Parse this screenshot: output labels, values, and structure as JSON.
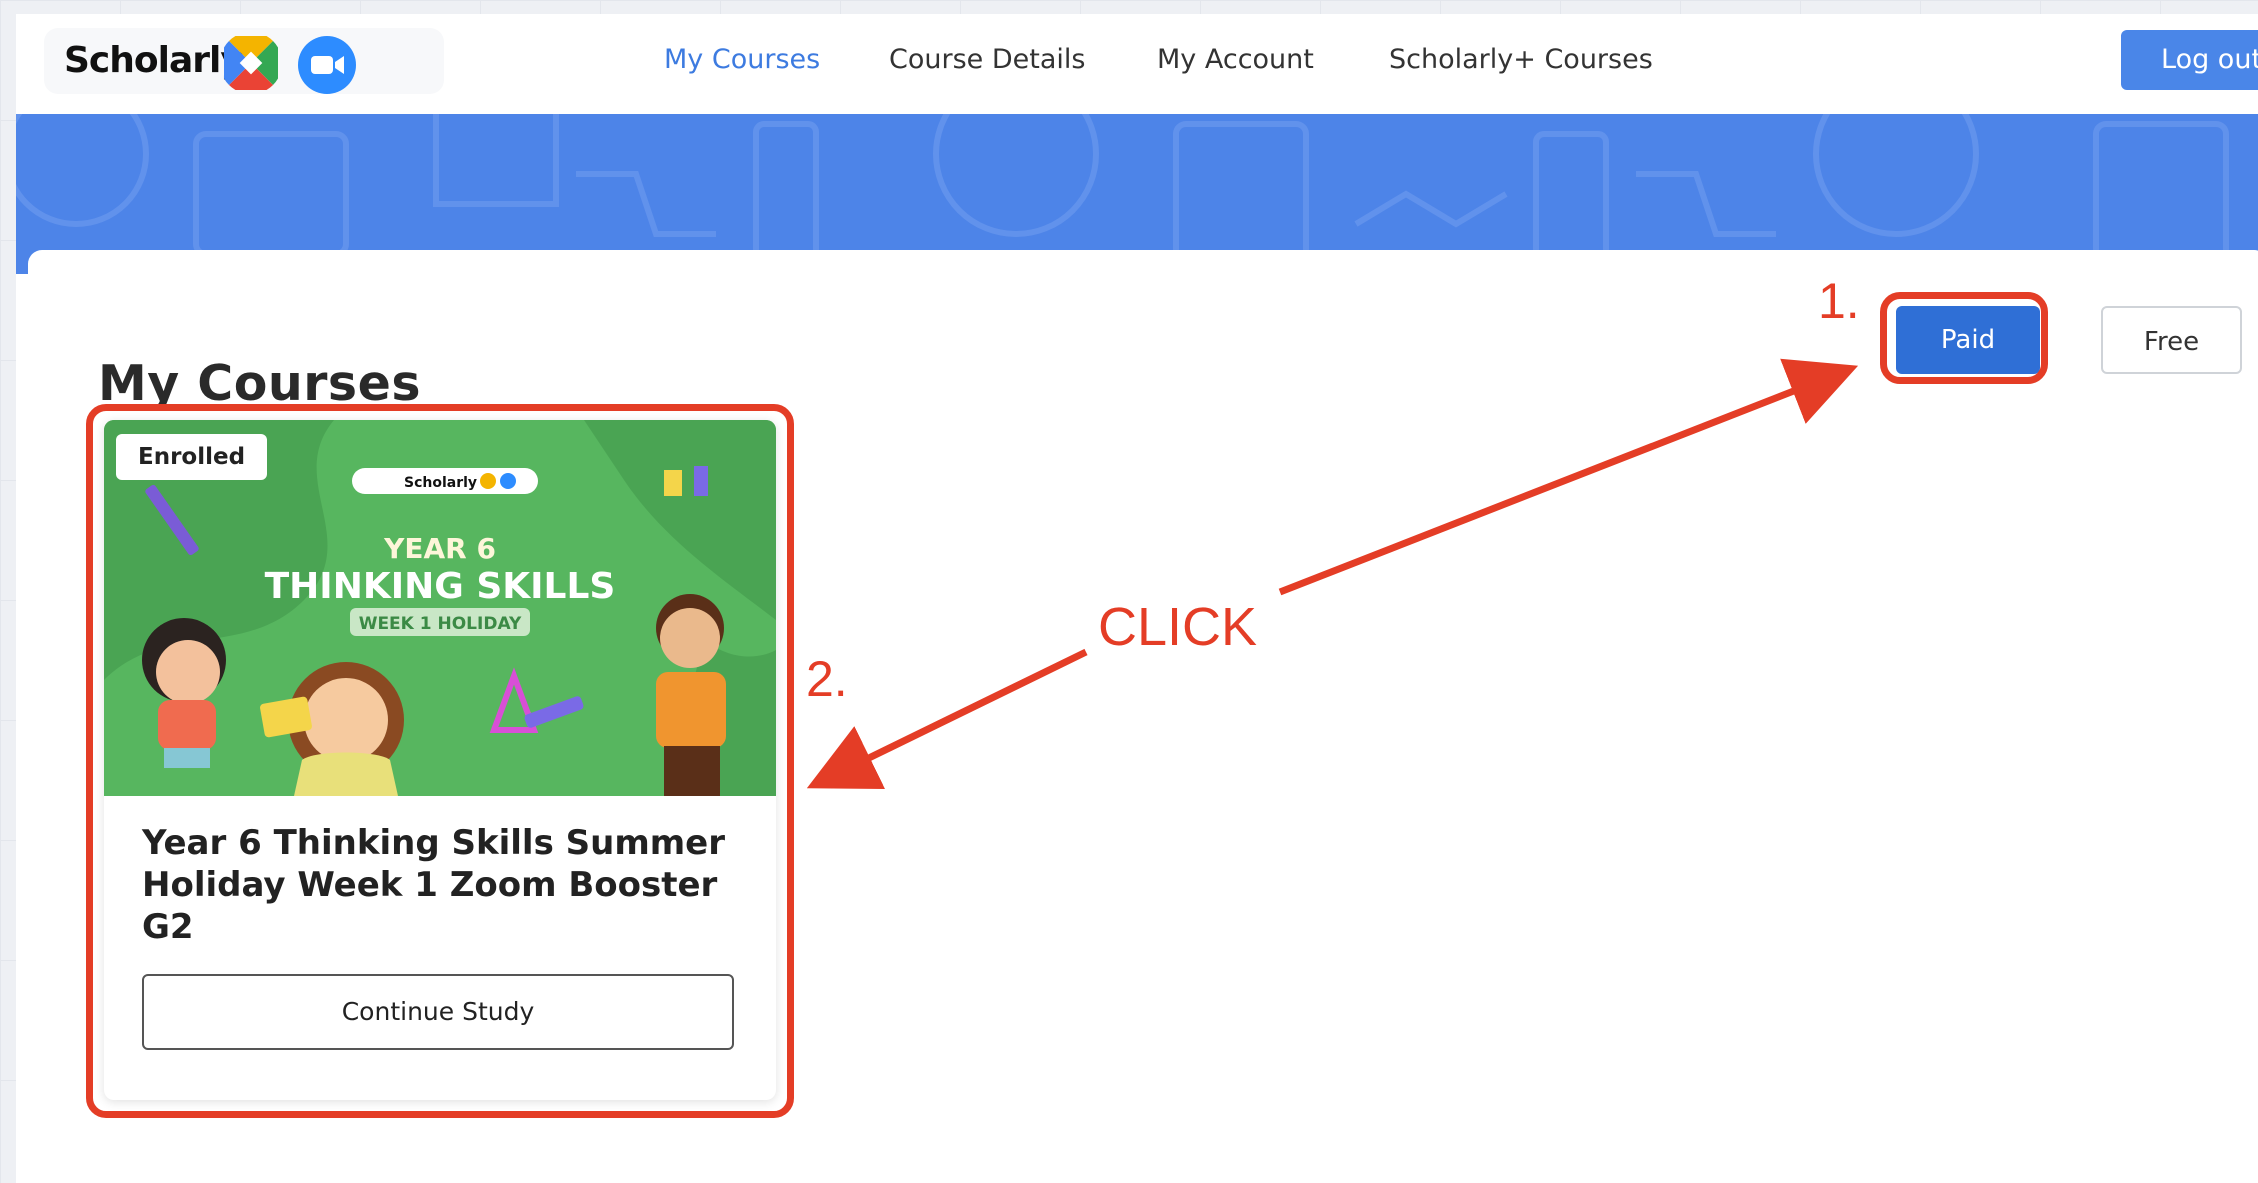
{
  "header": {
    "logo_text": "Scholarly",
    "nav": [
      {
        "label": "My Courses",
        "active": true
      },
      {
        "label": "Course Details",
        "active": false
      },
      {
        "label": "My Account",
        "active": false
      },
      {
        "label": "Scholarly+ Courses",
        "active": false
      }
    ],
    "logout_label": "Log out"
  },
  "page": {
    "title": "My Courses",
    "filters": {
      "paid_label": "Paid",
      "free_label": "Free",
      "selected": "Paid"
    }
  },
  "course": {
    "badge": "Enrolled",
    "thumbnail": {
      "logo_text": "Scholarly",
      "line1": "YEAR 6",
      "line2": "THINKING SKILLS",
      "line3": "WEEK 1 HOLIDAY"
    },
    "title": "Year 6 Thinking Skills Summer Holiday Week 1 Zoom Booster G2",
    "action_label": "Continue Study"
  },
  "annotations": {
    "step1": "1.",
    "step2": "2.",
    "click": "CLICK"
  },
  "colors": {
    "brand_blue": "#4a86e8",
    "annotation_red": "#e43d26",
    "thumbnail_green": "#57b65f"
  }
}
